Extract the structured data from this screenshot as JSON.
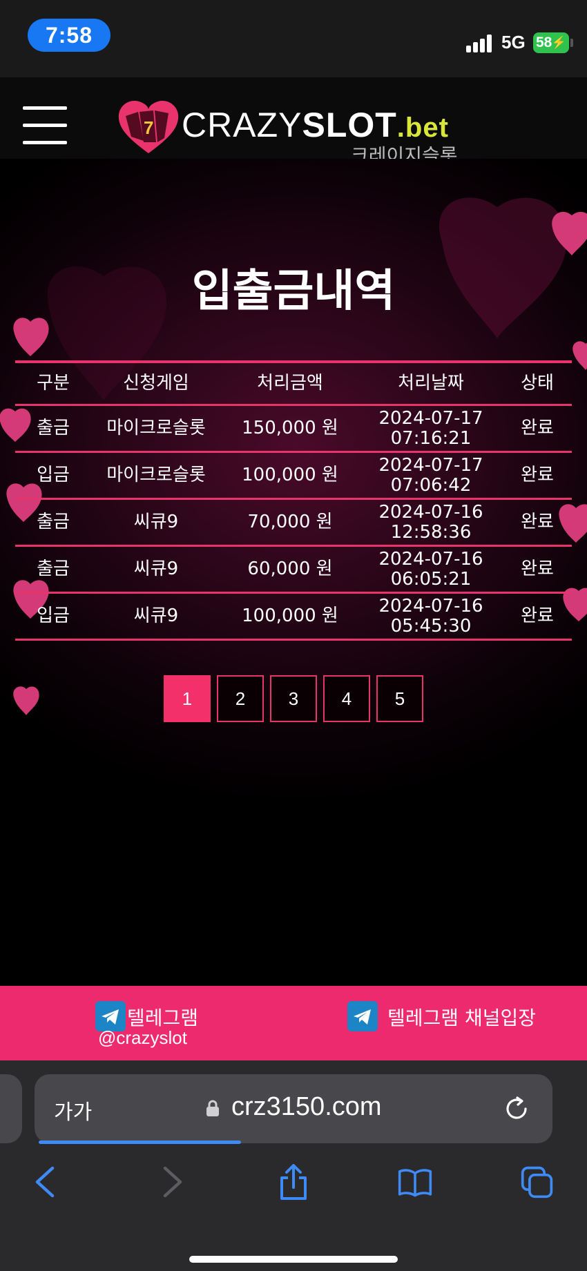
{
  "status_bar": {
    "time": "7:58",
    "network": "5G",
    "battery": "58"
  },
  "header": {
    "logo_light": "CRAZY",
    "logo_bold": "SLOT",
    "logo_tld": ".bet",
    "logo_sub": "크레이지슬롯"
  },
  "page": {
    "title": "입출금내역"
  },
  "table": {
    "headers": [
      "구분",
      "신청게임",
      "처리금액",
      "처리날짜",
      "상태"
    ],
    "rows": [
      {
        "type": "출금",
        "game": "마이크로슬롯",
        "amount": "150,000 원",
        "date": "2024-07-17",
        "time": "07:16:21",
        "status": "완료"
      },
      {
        "type": "입금",
        "game": "마이크로슬롯",
        "amount": "100,000 원",
        "date": "2024-07-17",
        "time": "07:06:42",
        "status": "완료"
      },
      {
        "type": "출금",
        "game": "씨큐9",
        "amount": "70,000 원",
        "date": "2024-07-16",
        "time": "12:58:36",
        "status": "완료"
      },
      {
        "type": "출금",
        "game": "씨큐9",
        "amount": "60,000 원",
        "date": "2024-07-16",
        "time": "06:05:21",
        "status": "완료"
      },
      {
        "type": "입금",
        "game": "씨큐9",
        "amount": "100,000 원",
        "date": "2024-07-16",
        "time": "05:45:30",
        "status": "완료"
      }
    ]
  },
  "pagination": {
    "pages": [
      "1",
      "2",
      "3",
      "4",
      "5"
    ],
    "active": "1"
  },
  "telegram": {
    "label": "텔레그램",
    "handle": "@crazyslot",
    "channel_label": "텔레그램 채널입장",
    "icon": "telegram-icon"
  },
  "browser": {
    "text_size_label": "가가",
    "url": "crz3150.com",
    "load_progress": 0.4
  },
  "colors": {
    "accent": "#ee2a6f",
    "table_border": "#e8336d",
    "active_page": "#f4306a",
    "time_pill": "#1877f2",
    "battery": "#2fc34d",
    "logo_tld": "#d8e63a",
    "telegram": "#1d84c6",
    "browser_blue": "#3e8af7"
  }
}
